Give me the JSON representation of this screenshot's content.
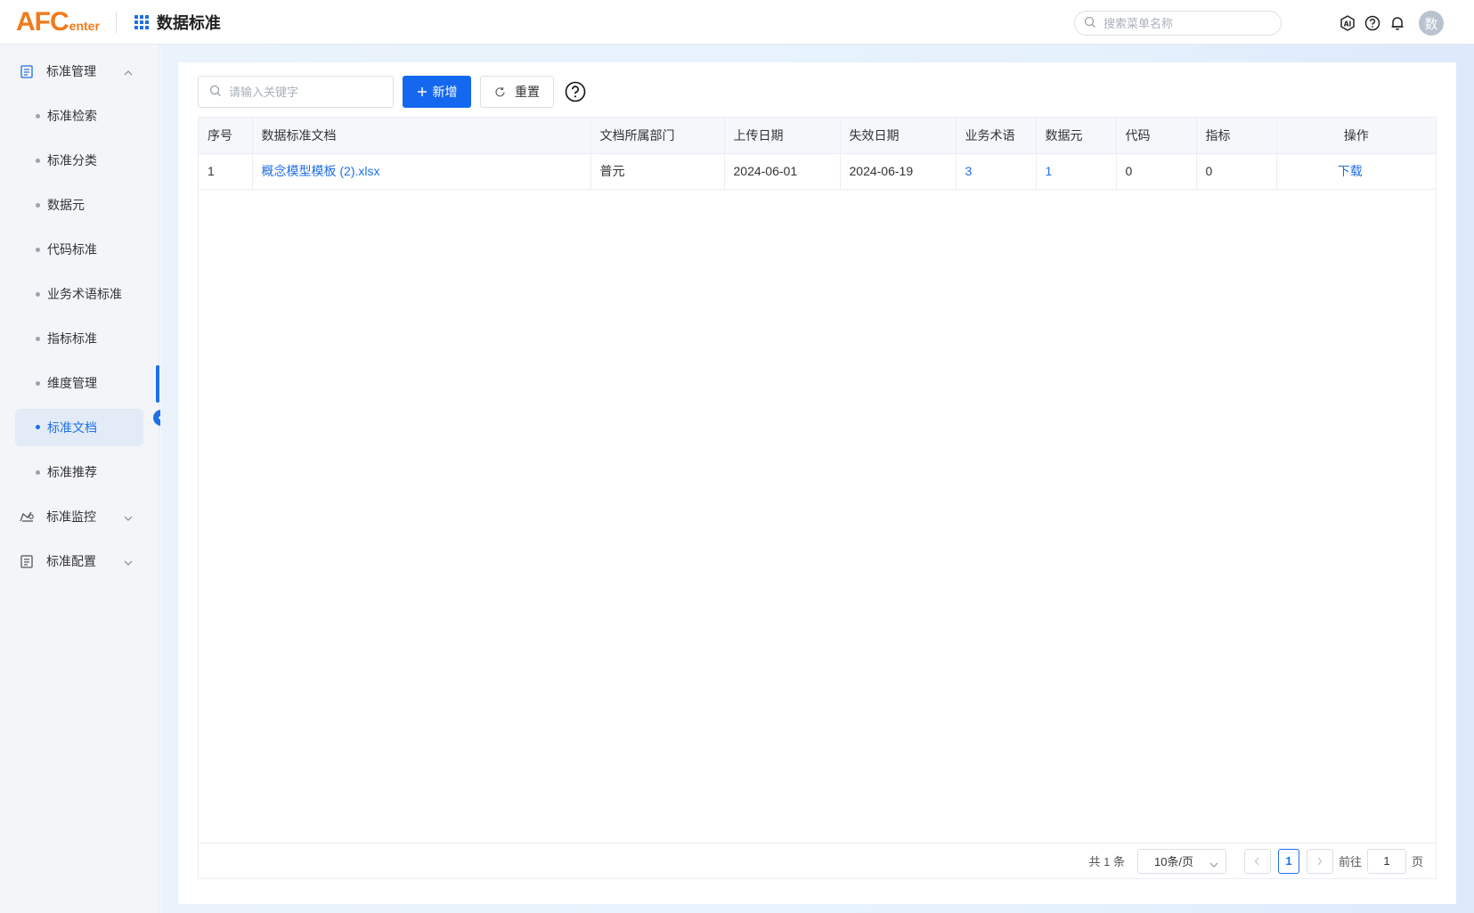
{
  "header": {
    "logo_big": "AFC",
    "logo_small": "enter",
    "app_title": "数据标准",
    "search_placeholder": "搜索菜单名称",
    "avatar_text": "数"
  },
  "sidebar": {
    "groups": [
      {
        "label": "标准管理",
        "expanded": true
      },
      {
        "label": "标准监控",
        "expanded": false
      },
      {
        "label": "标准配置",
        "expanded": false
      }
    ],
    "items": [
      {
        "label": "标准检索"
      },
      {
        "label": "标准分类"
      },
      {
        "label": "数据元"
      },
      {
        "label": "代码标准"
      },
      {
        "label": "业务术语标准"
      },
      {
        "label": "指标标准"
      },
      {
        "label": "维度管理"
      },
      {
        "label": "标准文档",
        "active": true
      },
      {
        "label": "标准推荐"
      }
    ]
  },
  "toolbar": {
    "keyword_placeholder": "请输入关键字",
    "add_label": "新增",
    "reset_label": "重置"
  },
  "table": {
    "columns": [
      "序号",
      "数据标准文档",
      "文档所属部门",
      "上传日期",
      "失效日期",
      "业务术语",
      "数据元",
      "代码",
      "指标",
      "操作"
    ],
    "rows": [
      {
        "index": "1",
        "document": "概念模型模板 (2).xlsx",
        "department": "普元",
        "upload_date": "2024-06-01",
        "expire_date": "2024-06-19",
        "terms": "3",
        "data_elements": "1",
        "codes": "0",
        "metrics": "0",
        "action": "下载"
      }
    ]
  },
  "pagination": {
    "total_text": "共 1 条",
    "page_size": "10条/页",
    "current_page": "1",
    "goto_label": "前往",
    "goto_value": "1",
    "page_suffix": "页"
  },
  "colors": {
    "primary": "#1468f0",
    "link": "#1f6fe8",
    "logo": "#f27a1a"
  }
}
